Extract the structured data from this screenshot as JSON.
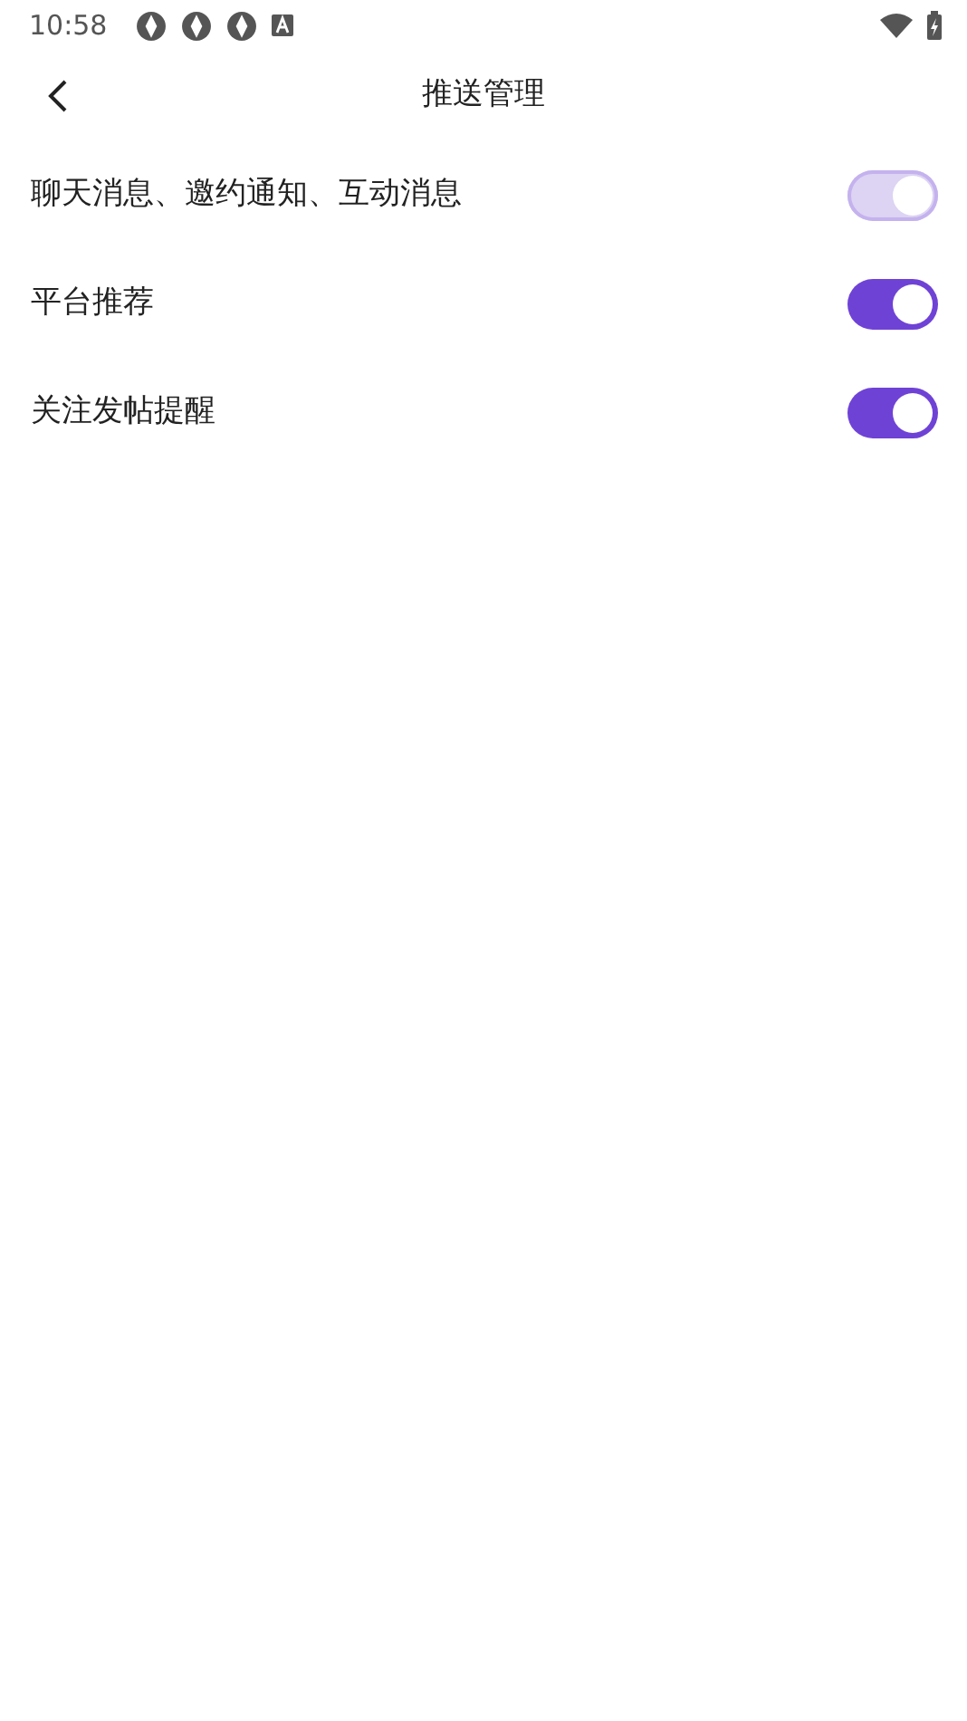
{
  "status_bar": {
    "time": "10:58"
  },
  "header": {
    "title": "推送管理"
  },
  "settings": [
    {
      "label": "聊天消息、邀约通知、互动消息",
      "checked": true,
      "disabled": true
    },
    {
      "label": "平台推荐",
      "checked": true,
      "disabled": false
    },
    {
      "label": "关注发帖提醒",
      "checked": true,
      "disabled": false
    }
  ]
}
